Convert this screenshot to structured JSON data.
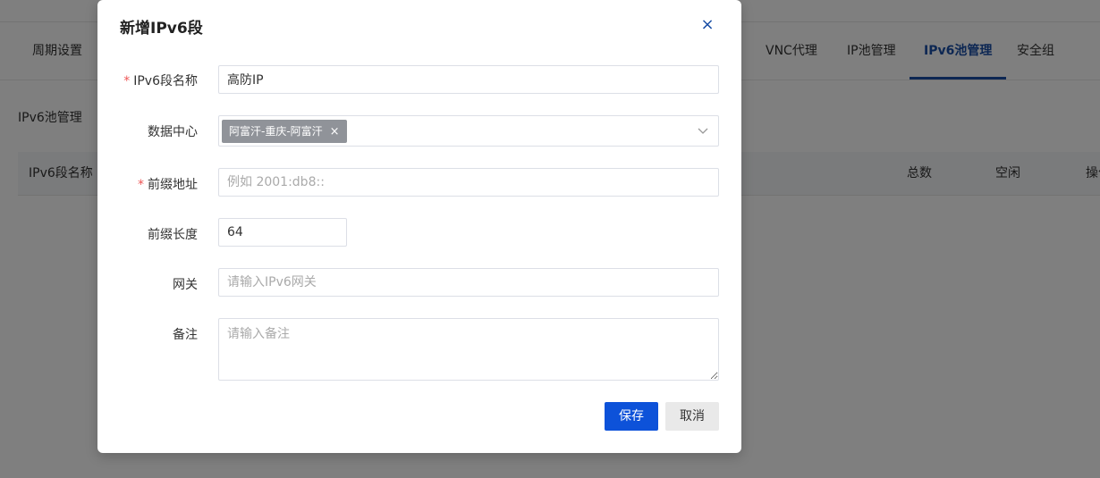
{
  "background": {
    "tabs": [
      {
        "label": "周期设置",
        "active": false
      },
      {
        "label": "VNC代理",
        "active": false
      },
      {
        "label": "IP池管理",
        "active": false
      },
      {
        "label": "IPv6池管理",
        "active": true
      },
      {
        "label": "安全组",
        "active": false
      }
    ],
    "section_title": "IPv6池管理",
    "table_headers": [
      "IPv6段名称",
      "总数",
      "空闲",
      "操作"
    ]
  },
  "modal": {
    "title": "新增IPv6段",
    "close_symbol": "×",
    "required_mark": "*",
    "fields": {
      "name": {
        "label": "IPv6段名称",
        "value": "高防IP"
      },
      "datacenter": {
        "label": "数据中心",
        "tag": "阿富汗-重庆-阿富汗",
        "tag_remove": "×"
      },
      "prefix": {
        "label": "前缀地址",
        "placeholder": "例如 2001:db8::"
      },
      "prefix_len": {
        "label": "前缀长度",
        "value": "64"
      },
      "gateway": {
        "label": "网关",
        "placeholder": "请输入IPv6网关"
      },
      "remark": {
        "label": "备注",
        "placeholder": "请输入备注"
      }
    },
    "buttons": {
      "save": "保存",
      "cancel": "取消"
    }
  },
  "colors": {
    "primary": "#0d52d9",
    "active_tab": "#1a4fa6",
    "required": "#e55555",
    "tag_bg": "#909399"
  }
}
